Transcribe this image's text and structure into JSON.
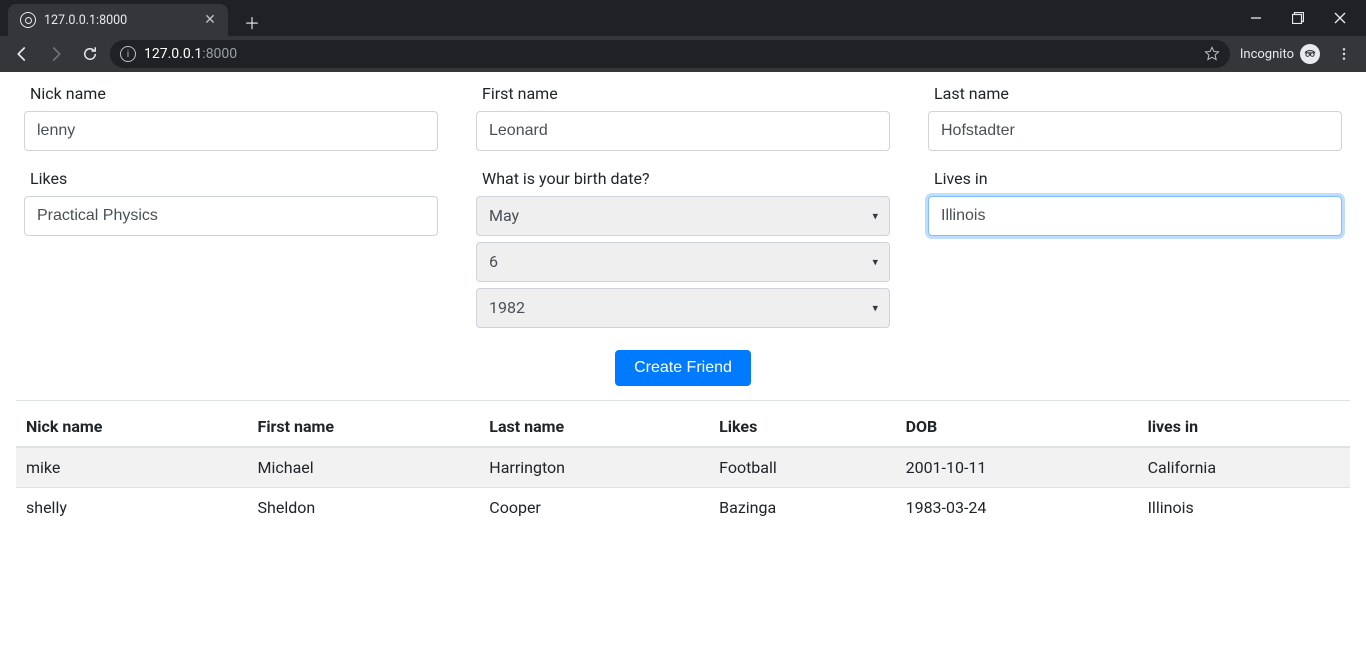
{
  "browser": {
    "tab_title": "127.0.0.1:8000",
    "url_host": "127.0.0.1",
    "url_port": ":8000",
    "incognito_label": "Incognito"
  },
  "form": {
    "nickname": {
      "label": "Nick name",
      "value": "lenny"
    },
    "firstname": {
      "label": "First name",
      "value": "Leonard"
    },
    "lastname": {
      "label": "Last name",
      "value": "Hofstadter"
    },
    "likes": {
      "label": "Likes",
      "value": "Practical Physics"
    },
    "birthdate": {
      "label": "What is your birth date?",
      "month": "May",
      "day": "6",
      "year": "1982"
    },
    "livesin": {
      "label": "Lives in",
      "value": "Illinois"
    },
    "submit_label": "Create Friend"
  },
  "table": {
    "headers": {
      "nick": "Nick name",
      "first": "First name",
      "last": "Last name",
      "likes": "Likes",
      "dob": "DOB",
      "livesin": "lives in"
    },
    "rows": [
      {
        "nick": "mike",
        "first": "Michael",
        "last": "Harrington",
        "likes": "Football",
        "dob": "2001-10-11",
        "livesin": "California"
      },
      {
        "nick": "shelly",
        "first": "Sheldon",
        "last": "Cooper",
        "likes": "Bazinga",
        "dob": "1983-03-24",
        "livesin": "Illinois"
      }
    ]
  }
}
